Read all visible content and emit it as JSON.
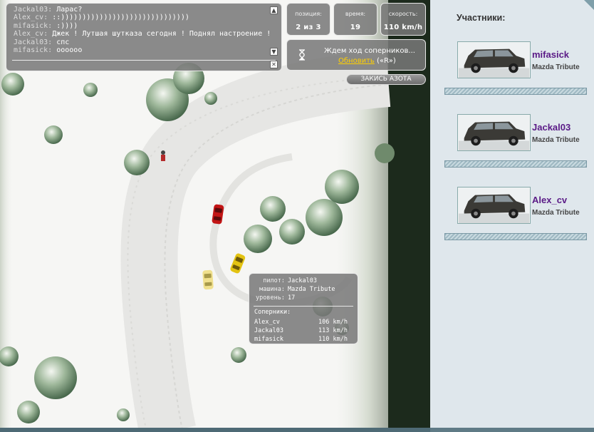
{
  "chat": {
    "lines": [
      {
        "nick": "Jackal03:",
        "msg": "Ларас?"
      },
      {
        "nick": "Alex_cv:",
        "msg": "::))))))))))))))))))))))))))))))"
      },
      {
        "nick": "mifasick:",
        "msg": ":))))"
      },
      {
        "nick": "Alex_cv:",
        "msg": "Джек ! Лутшая шутказа сегодня ! Поднял настроение !"
      },
      {
        "nick": "Jackal03:",
        "msg": "спс"
      },
      {
        "nick": "mifasick:",
        "msg": "oooooo"
      }
    ],
    "scroll_up_icon": "triangle-up-icon",
    "scroll_down_icon": "triangle-down-icon",
    "close_icon": "close-x-icon"
  },
  "stats": {
    "position": {
      "label": "позиция:",
      "value": "2 из 3"
    },
    "time": {
      "label": "время:",
      "value": "19"
    },
    "speed": {
      "label": "скорость:",
      "value": "110 km/h"
    }
  },
  "wait": {
    "text": "Ждем ход соперников...",
    "refresh_link": "Обновить",
    "refresh_hint": "(«R»)",
    "icon": "hourglass-icon"
  },
  "nitro": {
    "label": "ЗАКИСЬ АЗОТА"
  },
  "info": {
    "pilot_label": "пилот:",
    "pilot": "Jackal03",
    "car_label": "машина:",
    "car": "Mazda Tribute",
    "level_label": "уровень:",
    "level": "17",
    "rivals_label": "Соперники:",
    "rivals": [
      {
        "name": "Alex_cv",
        "speed": "106 km/h"
      },
      {
        "name": "Jackal03",
        "speed": "113 km/h"
      },
      {
        "name": "mifasick",
        "speed": "110 km/h"
      }
    ]
  },
  "sidebar": {
    "title": "Участники:",
    "players": [
      {
        "name": "mifasick",
        "car": "Mazda Tribute"
      },
      {
        "name": "Jackal03",
        "car": "Mazda Tribute"
      },
      {
        "name": "Alex_cv",
        "car": "Mazda Tribute"
      }
    ]
  },
  "colors": {
    "player_name": "#5a1a86",
    "refresh_link": "#ffd000",
    "sidebar_bg": "#dfe7ec",
    "car_red": "#c21515",
    "car_yellow": "#e3c312"
  }
}
